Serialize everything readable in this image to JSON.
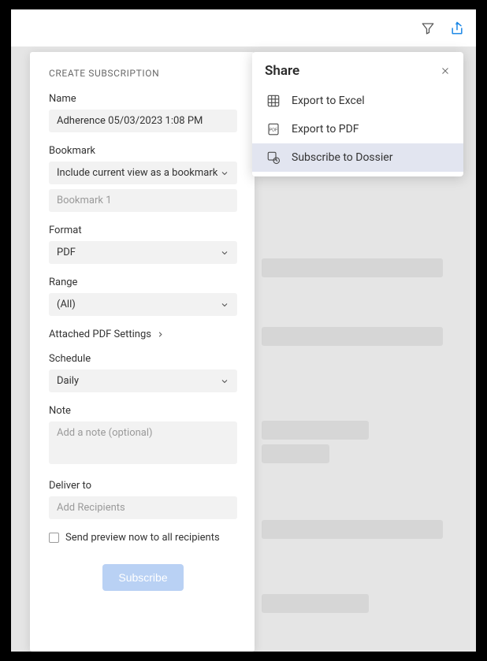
{
  "header": {},
  "share": {
    "title": "Share",
    "items": [
      {
        "label": "Export to Excel"
      },
      {
        "label": "Export to PDF"
      },
      {
        "label": "Subscribe to Dossier"
      }
    ]
  },
  "panel": {
    "heading": "CREATE SUBSCRIPTION",
    "name_label": "Name",
    "name_value": "Adherence 05/03/2023 1:08 PM",
    "bookmark_label": "Bookmark",
    "bookmark_mode": "Include current view as a bookmark",
    "bookmark_name": "Bookmark 1",
    "format_label": "Format",
    "format_value": "PDF",
    "range_label": "Range",
    "range_value": "(All)",
    "attached_settings": "Attached PDF Settings",
    "schedule_label": "Schedule",
    "schedule_value": "Daily",
    "note_label": "Note",
    "note_placeholder": "Add a note (optional)",
    "deliver_label": "Deliver to",
    "deliver_placeholder": "Add Recipients",
    "preview_checkbox": "Send preview now to all recipients",
    "subscribe_button": "Subscribe"
  }
}
